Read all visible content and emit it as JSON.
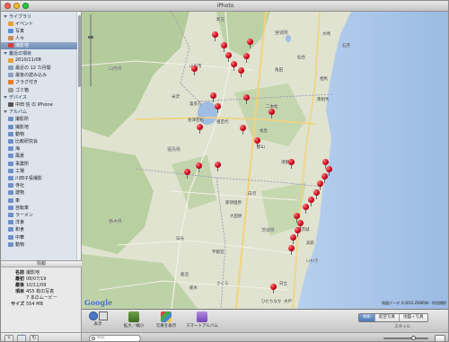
{
  "window": {
    "title": "iPhoto"
  },
  "sidebar": {
    "library_header": "ライブラリ",
    "library": [
      {
        "label": "イベント",
        "icon": "events-icon",
        "color": "#e8a23a"
      },
      {
        "label": "写真",
        "icon": "photos-icon",
        "color": "#5a8fd8"
      },
      {
        "label": "人々",
        "icon": "faces-icon",
        "color": "#c98c5a"
      },
      {
        "label": "撮影地",
        "icon": "places-icon",
        "color": "#d04040"
      }
    ],
    "recent_header": "最近の項目",
    "recent": [
      {
        "label": "2010/11/08",
        "icon": "event-icon",
        "color": "#e8a23a"
      },
      {
        "label": "最近の 12 カ月間",
        "icon": "calendar-icon",
        "color": "#8aa0c0"
      },
      {
        "label": "最後の読み込み",
        "icon": "import-icon",
        "color": "#8aa0c0"
      },
      {
        "label": "フラグ付き",
        "icon": "flag-icon",
        "color": "#e87a2a"
      },
      {
        "label": "ゴミ箱",
        "icon": "trash-icon",
        "color": "#9a9a9a"
      }
    ],
    "devices_header": "デバイス",
    "devices": [
      {
        "label": "中田 信 の iPhone",
        "icon": "iphone-icon",
        "color": "#555555"
      }
    ],
    "albums_header": "アルバム",
    "albums": [
      {
        "label": "撮影所",
        "icon": "album-icon",
        "color": "#6f8fc7"
      },
      {
        "label": "撮影地",
        "icon": "album-icon",
        "color": "#6f8fc7"
      },
      {
        "label": "動物",
        "icon": "album-icon",
        "color": "#6f8fc7"
      },
      {
        "label": "比較研究会",
        "icon": "album-icon",
        "color": "#6f8fc7"
      },
      {
        "label": "海",
        "icon": "album-icon",
        "color": "#6f8fc7"
      },
      {
        "label": "風景",
        "icon": "album-icon",
        "color": "#6f8fc7"
      },
      {
        "label": "事業所",
        "icon": "album-icon",
        "color": "#6f8fc7"
      },
      {
        "label": "工場",
        "icon": "album-icon",
        "color": "#6f8fc7"
      },
      {
        "label": "川田子役撮影",
        "icon": "album-icon",
        "color": "#6f8fc7"
      },
      {
        "label": "寺社",
        "icon": "album-icon",
        "color": "#6f8fc7"
      },
      {
        "label": "建物",
        "icon": "album-icon",
        "color": "#6f8fc7"
      },
      {
        "label": "車",
        "icon": "album-icon",
        "color": "#6f8fc7"
      },
      {
        "label": "自転車",
        "icon": "album-icon",
        "color": "#6f8fc7"
      },
      {
        "label": "ラーメン",
        "icon": "album-icon",
        "color": "#6f8fc7"
      },
      {
        "label": "洋食",
        "icon": "album-icon",
        "color": "#6f8fc7"
      },
      {
        "label": "和食",
        "icon": "album-icon",
        "color": "#6f8fc7"
      },
      {
        "label": "中華",
        "icon": "album-icon",
        "color": "#6f8fc7"
      },
      {
        "label": "動物",
        "icon": "album-icon",
        "color": "#6f8fc7"
      }
    ]
  },
  "info": {
    "header": "情報",
    "rows": [
      {
        "key": "名前",
        "value": "撮影地"
      },
      {
        "key": "最初",
        "value": "08/07/19"
      },
      {
        "key": "最後",
        "value": "10/11/09"
      },
      {
        "key": "項目",
        "value": "455 枚の写真"
      },
      {
        "key": "",
        "value": "7 本のムービー"
      },
      {
        "key": "サイズ",
        "value": "554 MB"
      }
    ]
  },
  "map": {
    "regions": [
      "山形県",
      "宮城県",
      "福島県",
      "栃木県",
      "茨城県"
    ],
    "cities": [
      "新庄",
      "山形市",
      "仙台",
      "米沢",
      "会津若松",
      "喜多方",
      "猪苗代",
      "郡山",
      "福島",
      "二本松",
      "須賀川",
      "白河",
      "いわき",
      "大田原",
      "那須塩原",
      "日光",
      "宇都宮",
      "水戸",
      "日立",
      "南相馬",
      "相馬",
      "角田",
      "大崎",
      "石巻",
      "鹿沼",
      "栃木",
      "さくら",
      "高萩",
      "北茨城",
      "ひたちなか"
    ],
    "copyright": "地図データ ©2010 ZENRIN - 利用規約",
    "google": "Google",
    "pin_count": 32
  },
  "toolbar": {
    "view_label": "表示",
    "zoom_label": "拡大／縮小",
    "show_photos_label": "写真を表示",
    "smart_album_label": "スマートアルバム",
    "map_style": [
      "地形",
      "航空写真",
      "地図＋写真"
    ],
    "map_style_selected": "地形",
    "style_caption": "スタイル"
  },
  "status": {
    "search_placeholder": "検索",
    "zoom_value": 0.68
  },
  "colors": {
    "pin": "#c8001a",
    "selection": "#6f8db5",
    "land": "#dfe3cf",
    "forest": "#b9cfa1",
    "sea": "#a8c4e6"
  }
}
